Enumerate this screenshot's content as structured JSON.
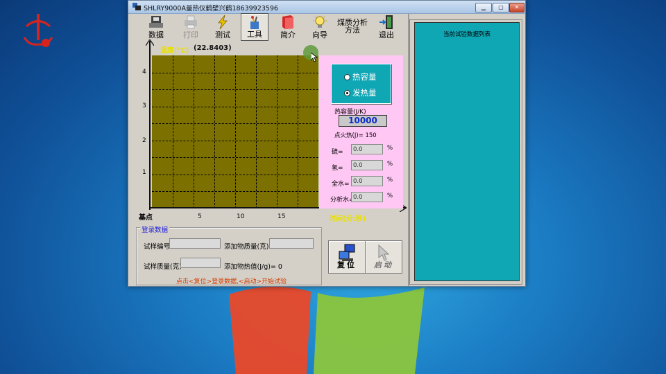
{
  "window": {
    "title": "SHLRY9000A量热仪鹤壁兴鹤18639923596",
    "buttons": {
      "minimize": "▁",
      "maximize": "▢",
      "close": "✕"
    }
  },
  "toolbar": [
    {
      "label": "数据",
      "icon": "data-icon",
      "enabled": true
    },
    {
      "label": "打印",
      "icon": "printer-icon",
      "enabled": false
    },
    {
      "label": "测试",
      "icon": "lightning-icon",
      "enabled": true
    },
    {
      "label": "工具",
      "icon": "tools-icon",
      "enabled": true,
      "active": true
    },
    {
      "label": "简介",
      "icon": "book-icon",
      "enabled": true
    },
    {
      "label": "向导",
      "icon": "lightbulb-icon",
      "enabled": true
    },
    {
      "label": "煤质分析方法",
      "line1": "煤质分析",
      "line2": "方法",
      "enabled": true
    },
    {
      "label": "退出",
      "icon": "exit-door-icon",
      "enabled": true
    }
  ],
  "chart": {
    "temp_label": "温度(℃)",
    "temp_value": "(22.8403)",
    "base_label": "基点",
    "time_label": "时间(分:秒)",
    "y_ticks": [
      "4",
      "3",
      "2",
      "1"
    ],
    "x_ticks": [
      "5",
      "10",
      "15"
    ]
  },
  "chart_data": {
    "type": "line",
    "title": "",
    "xlabel": "时间(分:秒)",
    "ylabel": "温度(℃)",
    "x_ticks": [
      5,
      10,
      15
    ],
    "y_ticks": [
      1,
      2,
      3,
      4
    ],
    "grid": true,
    "series": []
  },
  "side": {
    "radio_heat_capacity": "热容量",
    "radio_heat_value": "发热量",
    "selected": "发热量",
    "heat_capacity_label": "热容量(J/K)",
    "heat_capacity_value": "10000",
    "ignition_label": "点火热(J)= 150",
    "fields": [
      {
        "label": "硫=",
        "value": "0.0",
        "unit": "%"
      },
      {
        "label": "氢=",
        "value": "0.0",
        "unit": "%"
      },
      {
        "label": "全水=",
        "value": "0.0",
        "unit": "%"
      },
      {
        "label": "分析水=",
        "value": "0.0",
        "unit": "%"
      }
    ]
  },
  "login": {
    "title": "登录数据",
    "sample_no_label": "试样编号",
    "sample_no_value": "",
    "additive_mass_label": "添加物质量(克)",
    "additive_mass_value": "",
    "sample_mass_label": "试样质量(克)",
    "sample_mass_value": "",
    "additive_heat_label": "添加物热值(J/g)= 0",
    "hint": "点击<复位>登录数据,<启动>开始试验"
  },
  "actions": {
    "reset_label": "复位",
    "start_label": "启动"
  },
  "list": {
    "title": "当前试验数据列表"
  },
  "colors": {
    "plot": "#7c7100",
    "side": "#ffc8f4",
    "teal": "#10a7b5",
    "yellow_text": "#e8e000"
  }
}
